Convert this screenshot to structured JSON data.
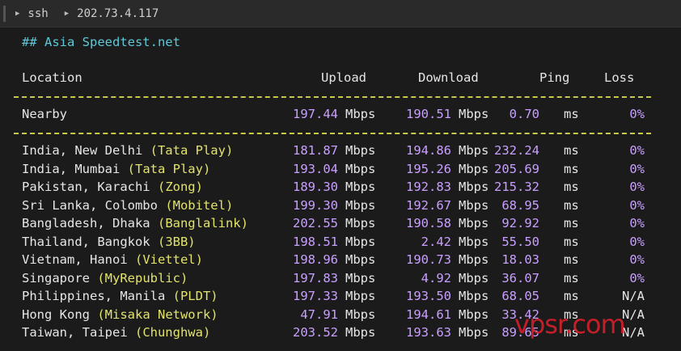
{
  "titlebar": {
    "command": "ssh",
    "host": "202.73.4.117"
  },
  "heading": "## Asia Speedtest.net",
  "headers": {
    "location": "Location",
    "upload": "Upload",
    "download": "Download",
    "ping": "Ping",
    "loss": "Loss"
  },
  "nearby": {
    "location": "Nearby",
    "upload": "197.44",
    "download": "190.51",
    "ping": "0.70",
    "loss": "0%"
  },
  "units": {
    "speed": "Mbps",
    "ping": "ms"
  },
  "rows": [
    {
      "place": "India, New Delhi ",
      "provider": "(Tata Play)",
      "upload": "181.87",
      "download": "194.86",
      "ping": "232.24",
      "loss": "0%"
    },
    {
      "place": "India, Mumbai ",
      "provider": "(Tata Play)",
      "upload": "193.04",
      "download": "195.26",
      "ping": "205.69",
      "loss": "0%"
    },
    {
      "place": "Pakistan, Karachi ",
      "provider": "(Zong)",
      "upload": "189.30",
      "download": "192.83",
      "ping": "215.32",
      "loss": "0%"
    },
    {
      "place": "Sri Lanka, Colombo ",
      "provider": "(Mobitel)",
      "upload": "199.30",
      "download": "192.67",
      "ping": "68.95",
      "loss": "0%"
    },
    {
      "place": "Bangladesh, Dhaka ",
      "provider": "(Banglalink)",
      "upload": "202.55",
      "download": "190.58",
      "ping": "92.92",
      "loss": "0%"
    },
    {
      "place": "Thailand, Bangkok ",
      "provider": "(3BB)",
      "upload": "198.51",
      "download": "2.42",
      "ping": "55.50",
      "loss": "0%"
    },
    {
      "place": "Vietnam, Hanoi ",
      "provider": "(Viettel)",
      "upload": "198.96",
      "download": "190.73",
      "ping": "18.03",
      "loss": "0%"
    },
    {
      "place": "Singapore ",
      "provider": "(MyRepublic)",
      "upload": "197.83",
      "download": "4.92",
      "ping": "36.07",
      "loss": "0%"
    },
    {
      "place": "Philippines, Manila ",
      "provider": "(PLDT)",
      "upload": "197.33",
      "download": "193.50",
      "ping": "68.05",
      "loss": "N/A"
    },
    {
      "place": "Hong Kong ",
      "provider": "(Misaka Network)",
      "upload": "47.91",
      "download": "194.61",
      "ping": "33.42",
      "loss": "N/A"
    },
    {
      "place": "Taiwan, Taipei ",
      "provider": "(Chunghwa)",
      "upload": "203.52",
      "download": "193.63",
      "ping": "89.65",
      "loss": "N/A"
    }
  ],
  "watermark": "vpsr.com"
}
